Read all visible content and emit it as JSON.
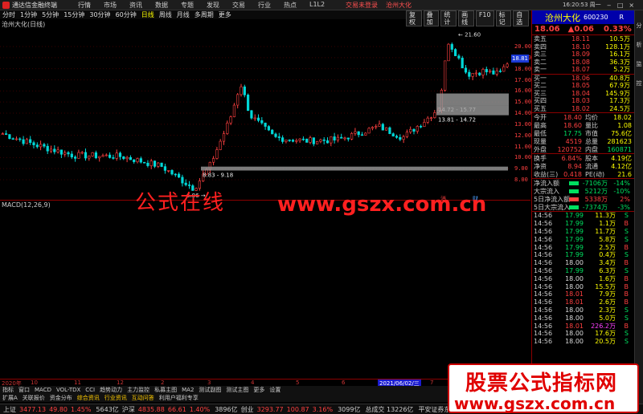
{
  "titlebar": {
    "app_title": "通达信金融终端",
    "menu": [
      "行情",
      "市场",
      "资讯",
      "数据",
      "专题",
      "发现",
      "交易",
      "行业",
      "热点",
      "L1L2"
    ],
    "center_links": [
      "交易未登录",
      "沧州大化"
    ],
    "time": "16:20:53 周一"
  },
  "toolbar": {
    "periods": [
      "分时",
      "1分钟",
      "5分钟",
      "15分钟",
      "30分钟",
      "60分钟",
      "日线",
      "周线",
      "月线",
      "多周期",
      "更多"
    ],
    "active": "日线",
    "right_tools": [
      "复权",
      "叠加",
      "统计",
      "画线",
      "F10",
      "标记",
      "自选"
    ]
  },
  "chart": {
    "title": "沧州大化(日线)",
    "current_price_tag": "18.81",
    "annotations": {
      "high": "21.60",
      "low": "6.86",
      "zone1": "8.83 - 9.18",
      "zone2": "13.81 - 14.72",
      "zone3": "14.72 - 15.77"
    },
    "yticks": [
      "20.00",
      "19.00",
      "18.00",
      "17.00",
      "16.00",
      "15.00",
      "14.00",
      "13.00",
      "12.00",
      "11.00",
      "10.00",
      "9.00",
      "8.00"
    ],
    "macd_title": "MACD(12,26,9)",
    "markers": [
      "消",
      "财"
    ]
  },
  "timeaxis": {
    "labels": [
      "2020年",
      "10",
      "11",
      "12",
      "2",
      "3",
      "4",
      "5",
      "6",
      "7"
    ],
    "selected": "2021/06/02/三"
  },
  "tabs1": [
    "指标",
    "窗口",
    "MACD",
    "VOL-TDX",
    "CCI",
    "趋势动力",
    "主力监控",
    "私募主图",
    "MA2",
    "测试副图",
    "测试主图",
    "更多",
    "设置"
  ],
  "tabs2": [
    "扩展A",
    "关联报价",
    "资金分布",
    "综合资讯",
    "行业资讯",
    "互动问答",
    "利用户福利专享"
  ],
  "tabs2_highlight": [
    "综合资讯",
    "行业资讯",
    "互动问答"
  ],
  "statusbar": [
    {
      "label": "上证",
      "price": "3477.13",
      "chg": "49.80",
      "pct": "1.45%",
      "vol": "5643亿"
    },
    {
      "label": "沪深",
      "price": "4835.88",
      "chg": "66.61",
      "pct": "1.40%",
      "vol": "3896亿"
    },
    {
      "label": "创业",
      "price": "3293.77",
      "chg": "100.87",
      "pct": "3.16%",
      "vol": "3099亿"
    }
  ],
  "status_tail": "总成交 13226亿",
  "status_broker": "平安证券东莞...",
  "stock": {
    "name": "沧州大化",
    "code": "600230",
    "r_tag": "R",
    "price": "18.06",
    "change": "▲0.06",
    "pct": "0.33%",
    "asks": [
      {
        "label": "卖五",
        "price": "18.11",
        "vol": "10.5万"
      },
      {
        "label": "卖四",
        "price": "18.10",
        "vol": "128.1万"
      },
      {
        "label": "卖三",
        "price": "18.09",
        "vol": "16.1万"
      },
      {
        "label": "卖二",
        "price": "18.08",
        "vol": "36.3万"
      },
      {
        "label": "卖一",
        "price": "18.07",
        "vol": "5.2万"
      }
    ],
    "bids": [
      {
        "label": "买一",
        "price": "18.06",
        "vol": "40.8万"
      },
      {
        "label": "买二",
        "price": "18.05",
        "vol": "67.9万"
      },
      {
        "label": "买三",
        "price": "18.04",
        "vol": "145.9万"
      },
      {
        "label": "买四",
        "price": "18.03",
        "vol": "17.3万"
      },
      {
        "label": "买五",
        "price": "18.02",
        "vol": "24.5万"
      }
    ],
    "stats": [
      {
        "k": "今开",
        "v": "18.40",
        "k2": "均价",
        "v2": "18.02"
      },
      {
        "k": "最高",
        "v": "18.60",
        "k2": "量比",
        "v2": "1.08"
      },
      {
        "k": "最低",
        "v": "17.75",
        "k2": "市值",
        "v2": "75.6亿"
      },
      {
        "k": "现量",
        "v": "4519",
        "k2": "总量",
        "v2": "281623"
      },
      {
        "k": "外盘",
        "v": "120752",
        "k2": "内盘",
        "v2": "160871"
      }
    ],
    "stats2": [
      {
        "k": "换手",
        "v": "6.84%",
        "k2": "股本",
        "v2": "4.19亿"
      },
      {
        "k": "净资",
        "v": "8.94",
        "k2": "流通",
        "v2": "4.12亿"
      },
      {
        "k": "收益(三)",
        "v": "0.418",
        "k2": "PE(动)",
        "v2": "21.6"
      }
    ],
    "flows": [
      {
        "label": "净流入额",
        "value": "-7106万",
        "pct": "-14%",
        "color": "#00e060"
      },
      {
        "label": "大宗流入",
        "value": "5212万",
        "pct": "-10%",
        "color": "#00e060"
      },
      {
        "label": "5日净流入额",
        "value": "5338万",
        "pct": "2%",
        "color": "#ff4040"
      },
      {
        "label": "5日大宗流入",
        "value": "-7374万",
        "pct": "-3%",
        "color": "#00e060"
      }
    ],
    "ticks": [
      {
        "t": "14:56",
        "p": "17.99",
        "q": "11.3万",
        "s": "S"
      },
      {
        "t": "14:56",
        "p": "17.99",
        "q": "1.1万",
        "s": "B"
      },
      {
        "t": "14:56",
        "p": "17.99",
        "q": "11.7万",
        "s": "S"
      },
      {
        "t": "14:56",
        "p": "17.99",
        "q": "5.8万",
        "s": "S"
      },
      {
        "t": "14:56",
        "p": "17.99",
        "q": "2.5万",
        "s": "B"
      },
      {
        "t": "14:56",
        "p": "17.99",
        "q": "0.4万",
        "s": "S"
      },
      {
        "t": "14:56",
        "p": "18.00",
        "q": "3.4万",
        "s": "B"
      },
      {
        "t": "14:56",
        "p": "17.99",
        "q": "6.3万",
        "s": "S"
      },
      {
        "t": "14:56",
        "p": "18.00",
        "q": "1.6万",
        "s": "B"
      },
      {
        "t": "14:56",
        "p": "18.00",
        "q": "15.5万",
        "s": "B"
      },
      {
        "t": "14:56",
        "p": "18.01",
        "q": "7.9万",
        "s": "B"
      },
      {
        "t": "14:56",
        "p": "18.01",
        "q": "2.6万",
        "s": "B"
      },
      {
        "t": "14:56",
        "p": "18.00",
        "q": "2.3万",
        "s": "S"
      },
      {
        "t": "14:56",
        "p": "18.00",
        "q": "5.0万",
        "s": "S"
      },
      {
        "t": "14:56",
        "p": "18.01",
        "q": "226.2万",
        "s": "B"
      },
      {
        "t": "14:56",
        "p": "18.00",
        "q": "17.6万",
        "s": "S"
      },
      {
        "t": "14:56",
        "p": "18.00",
        "q": "20.5万",
        "s": "S"
      }
    ]
  },
  "sidebar": [
    "分",
    "析",
    "监",
    "控"
  ],
  "watermarks": {
    "text1": "公式在线",
    "text2": "www.gszx.com.cn",
    "badge1": "股票公式指标网",
    "badge2": "www.gszx.com.cn"
  },
  "colors": {
    "up": "#ff4040",
    "down": "#00e0e0",
    "accent": "#ffff00"
  }
}
